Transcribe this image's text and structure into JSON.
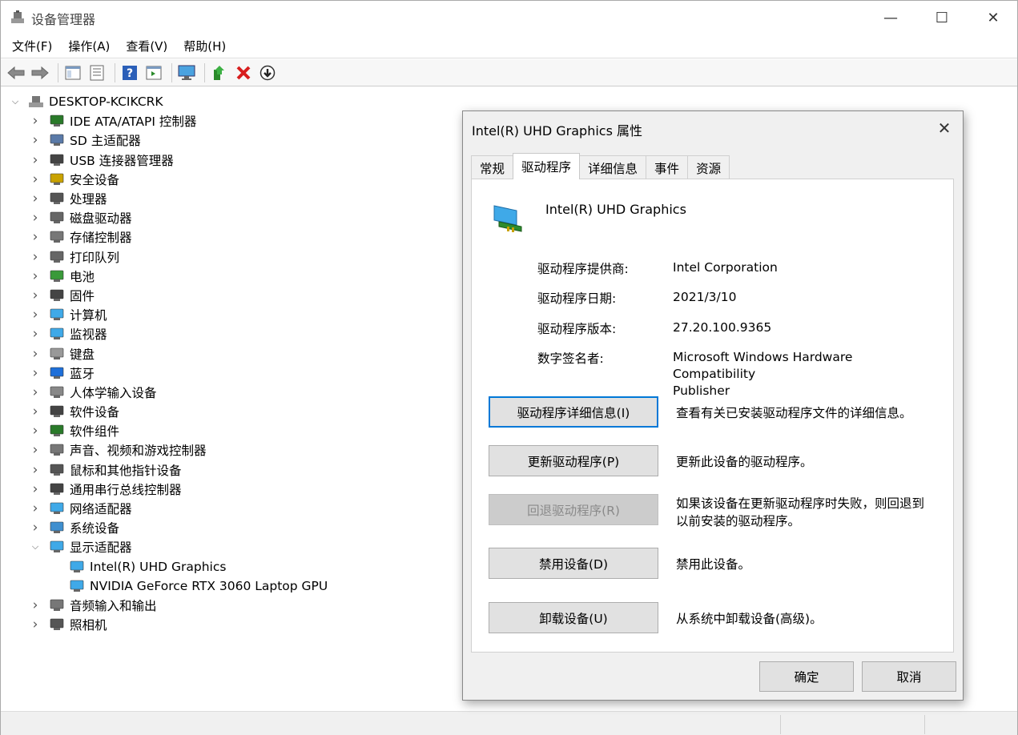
{
  "window": {
    "title": "设备管理器",
    "minimize_glyph": "—",
    "maximize_glyph": "☐",
    "close_glyph": "✕"
  },
  "menu": [
    "文件(F)",
    "操作(A)",
    "查看(V)",
    "帮助(H)"
  ],
  "toolbar": [
    "back-icon",
    "forward-icon",
    "show-hide-console-tree-icon",
    "properties-icon",
    "help-icon",
    "action-pane-icon",
    "scan-hardware-icon",
    "update-driver-icon",
    "uninstall-icon",
    "disable-device-icon"
  ],
  "tree": {
    "root": "DESKTOP-KCIKCRK",
    "categories": [
      {
        "label": "IDE ATA/ATAPI 控制器",
        "icon": "ide-controller-icon",
        "expanded": false
      },
      {
        "label": "SD 主适配器",
        "icon": "sd-adapter-icon",
        "expanded": false
      },
      {
        "label": "USB 连接器管理器",
        "icon": "usb-icon",
        "expanded": false
      },
      {
        "label": "安全设备",
        "icon": "security-device-icon",
        "expanded": false
      },
      {
        "label": "处理器",
        "icon": "processor-icon",
        "expanded": false
      },
      {
        "label": "磁盘驱动器",
        "icon": "disk-drive-icon",
        "expanded": false
      },
      {
        "label": "存储控制器",
        "icon": "storage-controller-icon",
        "expanded": false
      },
      {
        "label": "打印队列",
        "icon": "printer-icon",
        "expanded": false
      },
      {
        "label": "电池",
        "icon": "battery-icon",
        "expanded": false
      },
      {
        "label": "固件",
        "icon": "firmware-icon",
        "expanded": false
      },
      {
        "label": "计算机",
        "icon": "computer-icon",
        "expanded": false
      },
      {
        "label": "监视器",
        "icon": "monitor-icon",
        "expanded": false
      },
      {
        "label": "键盘",
        "icon": "keyboard-icon",
        "expanded": false
      },
      {
        "label": "蓝牙",
        "icon": "bluetooth-icon",
        "expanded": false
      },
      {
        "label": "人体学输入设备",
        "icon": "hid-icon",
        "expanded": false
      },
      {
        "label": "软件设备",
        "icon": "software-device-icon",
        "expanded": false
      },
      {
        "label": "软件组件",
        "icon": "software-component-icon",
        "expanded": false
      },
      {
        "label": "声音、视频和游戏控制器",
        "icon": "speaker-icon",
        "expanded": false
      },
      {
        "label": "鼠标和其他指针设备",
        "icon": "mouse-icon",
        "expanded": false
      },
      {
        "label": "通用串行总线控制器",
        "icon": "usb-controller-icon",
        "expanded": false
      },
      {
        "label": "网络适配器",
        "icon": "network-adapter-icon",
        "expanded": false
      },
      {
        "label": "系统设备",
        "icon": "system-device-icon",
        "expanded": false
      },
      {
        "label": "显示适配器",
        "icon": "display-adapter-icon",
        "expanded": true,
        "children": [
          "Intel(R) UHD Graphics",
          "NVIDIA GeForce RTX 3060 Laptop GPU"
        ]
      },
      {
        "label": "音频输入和输出",
        "icon": "audio-io-icon",
        "expanded": false
      },
      {
        "label": "照相机",
        "icon": "camera-icon",
        "expanded": false
      }
    ]
  },
  "dialog": {
    "title": "Intel(R) UHD Graphics 属性",
    "close_glyph": "✕",
    "tabs": [
      "常规",
      "驱动程序",
      "详细信息",
      "事件",
      "资源"
    ],
    "active_tab": "驱动程序",
    "device_name": "Intel(R) UHD Graphics",
    "properties": {
      "provider_label": "驱动程序提供商:",
      "provider_value": "Intel Corporation",
      "date_label": "驱动程序日期:",
      "date_value": "2021/3/10",
      "version_label": "驱动程序版本:",
      "version_value": "27.20.100.9365",
      "signer_label": "数字签名者:",
      "signer_value_line1": "Microsoft Windows Hardware Compatibility",
      "signer_value_line2": "Publisher"
    },
    "actions": {
      "details_label": "驱动程序详细信息(I)",
      "details_desc": "查看有关已安装驱动程序文件的详细信息。",
      "update_label": "更新驱动程序(P)",
      "update_desc": "更新此设备的驱动程序。",
      "rollback_label": "回退驱动程序(R)",
      "rollback_desc_line1": "如果该设备在更新驱动程序时失败，则回退到",
      "rollback_desc_line2": "以前安装的驱动程序。",
      "disable_label": "禁用设备(D)",
      "disable_desc": "禁用此设备。",
      "uninstall_label": "卸载设备(U)",
      "uninstall_desc": "从系统中卸载设备(高级)。"
    },
    "ok_label": "确定",
    "cancel_label": "取消"
  }
}
